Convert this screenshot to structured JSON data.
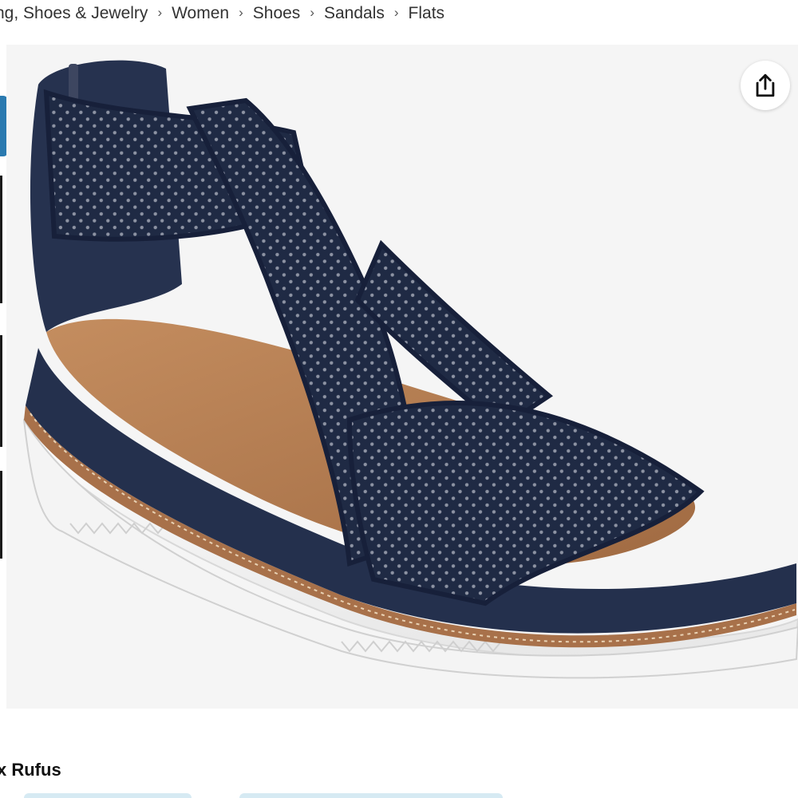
{
  "breadcrumb": {
    "items": [
      {
        "label": "ng, Shoes & Jewelry"
      },
      {
        "label": "Women"
      },
      {
        "label": "Shoes"
      },
      {
        "label": "Sandals"
      },
      {
        "label": "Flats"
      }
    ],
    "separator": "›"
  },
  "product": {
    "brand_partial": "x Rufus",
    "image_icon": "navy-knit-wedge-sandal",
    "colors": {
      "upper": "#1f2a44",
      "footbed": "#b07a4f",
      "sole": "#f2f2f2",
      "welt": "#a8714a"
    }
  },
  "actions": {
    "share_icon": "share-icon"
  },
  "theme": {
    "accent": "#2a7ab0",
    "image_background": "#f5f5f5"
  }
}
